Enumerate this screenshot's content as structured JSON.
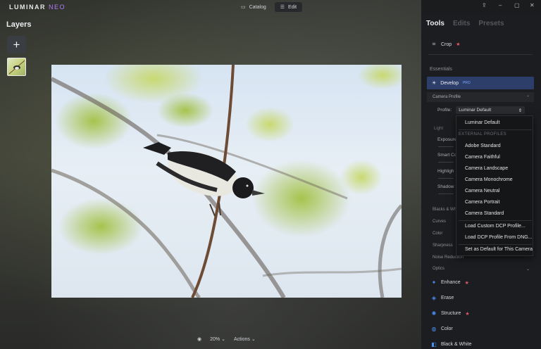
{
  "app": {
    "logo": "LUMINAR",
    "logo_suffix": "NEO"
  },
  "top_tabs": [
    {
      "label": "Catalog",
      "icon": "folder-icon"
    },
    {
      "label": "Edit",
      "icon": "sliders-icon"
    }
  ],
  "layers": {
    "title": "Layers"
  },
  "bottom": {
    "zoom": "20%",
    "actions": "Actions"
  },
  "panel": {
    "tabs": [
      "Tools",
      "Edits",
      "Presets"
    ],
    "crop": "Crop",
    "essentials": "Essentials",
    "develop": "Develop",
    "develop_badge": "PRO",
    "camera_profile": "Camera Profile",
    "profile_label": "Profile:",
    "profile_value": "Luminar Default",
    "light": "Light",
    "sliders": [
      "Exposure",
      "Smart Co",
      "Highligh",
      "Shadow"
    ],
    "collapsed": [
      "Blacks & Whites",
      "Curves",
      "Color",
      "Sharpness",
      "Noise Reduction"
    ],
    "optics": "Optics",
    "tools": [
      {
        "label": "Enhance",
        "starred": true
      },
      {
        "label": "Erase",
        "starred": false
      },
      {
        "label": "Structure",
        "starred": true
      },
      {
        "label": "Color",
        "starred": false
      },
      {
        "label": "Black & White",
        "starred": false
      }
    ]
  },
  "dropdown": {
    "default_item": "Luminar Default",
    "group_label": "EXTERNAL PROFILES",
    "profiles": [
      "Adobe Standard",
      "Camera Faithful",
      "Camera Landscape",
      "Camera Monochrome",
      "Camera Neutral",
      "Camera Portrait",
      "Camera Standard"
    ],
    "load_items": [
      "Load Custom DCP Profile...",
      "Load DCP Profile From DNG..."
    ],
    "set_default": "Set as Default for This Camera"
  },
  "colors": {
    "accent": "#2d3e6a",
    "star": "#e05a62",
    "badge": "#7fa6ff"
  }
}
